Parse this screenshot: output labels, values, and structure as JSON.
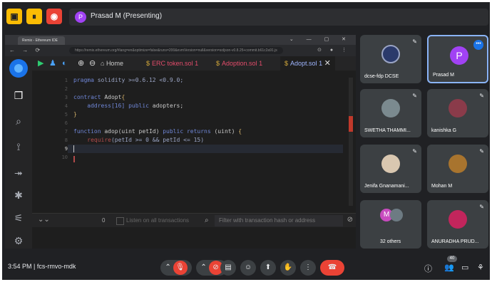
{
  "meet": {
    "presenting_avatar": "P",
    "presenting_label": "Prasad M (Presenting)",
    "time": "3:54 PM",
    "separator": "|",
    "meeting_code": "fcs-rmvo-mdk",
    "people_count": "40"
  },
  "browser": {
    "tab_title": "Remix - Ethereum IDE",
    "url": "https://remix.ethereum.org/#lang=en&optimize=false&runs=200&evmVersion=null&version=soljson-v0.8.25+commit.b61c2a91.js"
  },
  "remix": {
    "home_label": "Home",
    "tabs": [
      {
        "label": "ERC token.sol",
        "count": "1"
      },
      {
        "label": "Adoption.sol",
        "count": "1"
      },
      {
        "label": "Adopt.sol",
        "count": "1"
      }
    ],
    "line_numbers": [
      "1",
      "2",
      "3",
      "4",
      "5",
      "6",
      "7",
      "8",
      "9",
      "10"
    ],
    "code": {
      "l1_kw": "pragma",
      "l1_rest": " solidity >=0.6.12 <0.9.0;",
      "l3_kw": "contract",
      "l3_name": " Adopt",
      "l3_brace": "{",
      "l4_type": "    address[16]",
      "l4_kw": " public",
      "l4_name": " adopters;",
      "l5": "}",
      "l7_kw": "function",
      "l7_rest": " adop(uint petId) ",
      "l7_kw2": "public returns",
      "l7_rest2": " (uint) ",
      "l7_brace": "{",
      "l8_req": "    require",
      "l8_rest": "(petId >= 0 && petId <= 15)"
    },
    "terminal": {
      "count": "0",
      "listen_label": "Listen on all transactions",
      "filter_placeholder": "Filter with transaction hash or address"
    }
  },
  "participants": [
    {
      "name": "dcse-fdp DCSE"
    },
    {
      "name": "Prasad M",
      "avatar": "P"
    },
    {
      "name": "SWETHA THAMMI..."
    },
    {
      "name": "kanishka G"
    },
    {
      "name": "Jenifa Gnanamani..."
    },
    {
      "name": "Mohan M"
    },
    {
      "name": "32 others",
      "avatar": "M"
    },
    {
      "name": "ANURADHA PRUD..."
    }
  ],
  "colors": {
    "accent": "#1a73e8",
    "danger": "#ea4335",
    "presenting_avatar": "#a142f4",
    "remix_error": "#e34c6b"
  }
}
